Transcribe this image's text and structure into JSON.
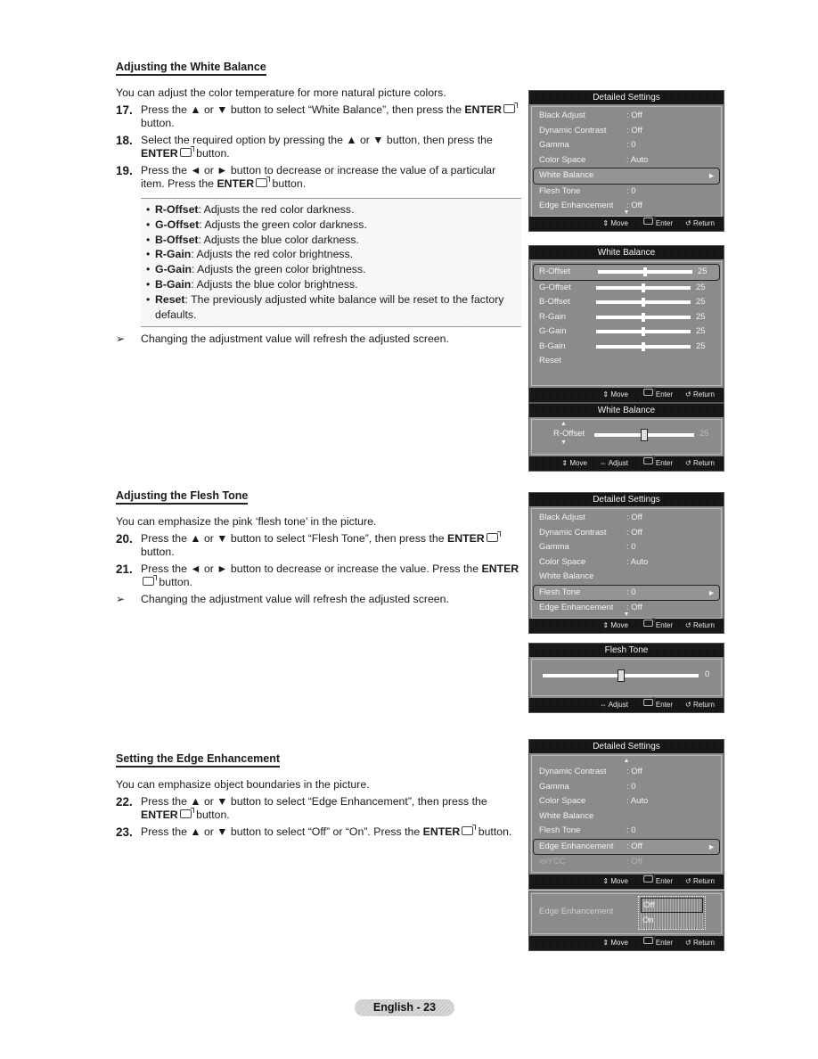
{
  "page": {
    "footer_label": "English - 23"
  },
  "icons": {
    "enter": "enter-icon",
    "up": "▲",
    "down": "▼",
    "left": "◄",
    "right": "►",
    "note": "➢",
    "move": "⇕",
    "adjust": "⇔",
    "return": "↺",
    "go": "►"
  },
  "white_balance": {
    "title": "Adjusting the White Balance",
    "intro": "You can adjust the color temperature for more natural picture colors.",
    "steps": [
      {
        "num": "17.",
        "pre": "Press the ▲ or ▼ button to select “White Balance”, then press the ",
        "bold": "ENTER",
        "post": " button."
      },
      {
        "num": "18.",
        "pre": "Select the required option by pressing the ▲ or ▼ button, then press the ",
        "bold": "ENTER",
        "post": " button."
      },
      {
        "num": "19.",
        "pre": "Press the ◄ or ► button to decrease or increase the value of a particular item. Press the ",
        "bold": "ENTER",
        "post": " button."
      }
    ],
    "bullets": [
      {
        "term": "R-Offset",
        "desc": ": Adjusts the red color darkness."
      },
      {
        "term": "G-Offset",
        "desc": ": Adjusts the green color darkness."
      },
      {
        "term": "B-Offset",
        "desc": ": Adjusts the blue color darkness."
      },
      {
        "term": "R-Gain",
        "desc": ": Adjusts the red color brightness."
      },
      {
        "term": "G-Gain",
        "desc": ": Adjusts the green color brightness."
      },
      {
        "term": "B-Gain",
        "desc": ": Adjusts the blue color brightness."
      },
      {
        "term": "Reset",
        "desc": ": The previously adjusted white balance will be reset to the factory defaults."
      }
    ],
    "note": "Changing the adjustment value will refresh the adjusted screen."
  },
  "flesh_tone": {
    "title": "Adjusting the Flesh Tone",
    "intro": "You can emphasize the pink ‘flesh tone’ in the picture.",
    "steps": [
      {
        "num": "20.",
        "pre": "Press the ▲ or ▼ button to select “Flesh Tone”, then press the ",
        "bold": "ENTER",
        "post": " button."
      },
      {
        "num": "21.",
        "pre": "Press the ◄ or ► button to decrease or increase the value. Press the ",
        "bold": "ENTER",
        "post": " button."
      }
    ],
    "note": "Changing the adjustment value will refresh the adjusted screen."
  },
  "edge": {
    "title": "Setting the Edge Enhancement",
    "intro": "You can emphasize object boundaries in the picture.",
    "steps": [
      {
        "num": "22.",
        "pre": "Press the ▲ or ▼ button to select “Edge Enhancement”, then press the ",
        "bold": "ENTER",
        "post": " button."
      },
      {
        "num": "23.",
        "pre": "Press the ▲ or ▼ button to select “Off” or “On”. Press the ",
        "bold": "ENTER",
        "post": " button."
      }
    ]
  },
  "osd": {
    "footer": {
      "move": "Move",
      "adjust": "Adjust",
      "enter": "Enter",
      "return": "Return"
    },
    "detailed1": {
      "title": "Detailed Settings",
      "rows": [
        {
          "label": "Black Adjust",
          "value": ": Off"
        },
        {
          "label": "Dynamic Contrast",
          "value": ": Off"
        },
        {
          "label": "Gamma",
          "value": ": 0"
        },
        {
          "label": "Color Space",
          "value": ": Auto"
        },
        {
          "label": "White Balance",
          "value": "",
          "selected": true
        },
        {
          "label": "Flesh Tone",
          "value": ": 0"
        },
        {
          "label": "Edge Enhancement",
          "value": ": Off"
        }
      ]
    },
    "wb_menu": {
      "title": "White Balance",
      "range": [
        0,
        50
      ],
      "rows": [
        {
          "label": "R-Offset",
          "value": 25,
          "selected": true
        },
        {
          "label": "G-Offset",
          "value": 25
        },
        {
          "label": "B-Offset",
          "value": 25
        },
        {
          "label": "R-Gain",
          "value": 25
        },
        {
          "label": "G-Gain",
          "value": 25
        },
        {
          "label": "B-Gain",
          "value": 25
        }
      ],
      "reset_label": "Reset"
    },
    "wb_adjust": {
      "title": "White Balance",
      "label": "R-Offset",
      "value": 25,
      "range": [
        0,
        50
      ]
    },
    "detailed2": {
      "title": "Detailed Settings",
      "rows": [
        {
          "label": "Black Adjust",
          "value": ": Off"
        },
        {
          "label": "Dynamic Contrast",
          "value": ": Off"
        },
        {
          "label": "Gamma",
          "value": ": 0"
        },
        {
          "label": "Color Space",
          "value": ": Auto"
        },
        {
          "label": "White Balance",
          "value": ""
        },
        {
          "label": "Flesh Tone",
          "value": ": 0",
          "selected": true
        },
        {
          "label": "Edge Enhancement",
          "value": ": Off"
        }
      ]
    },
    "flesh_adjust": {
      "title": "Flesh Tone",
      "value": 0,
      "range": [
        -15,
        15
      ]
    },
    "detailed3": {
      "title": "Detailed Settings",
      "rows": [
        {
          "label": "Dynamic Contrast",
          "value": ": Off"
        },
        {
          "label": "Gamma",
          "value": ": 0"
        },
        {
          "label": "Color Space",
          "value": ": Auto"
        },
        {
          "label": "White Balance",
          "value": ""
        },
        {
          "label": "Flesh Tone",
          "value": ": 0"
        },
        {
          "label": "Edge Enhancement",
          "value": ": Off",
          "selected": true
        },
        {
          "label": "xvYCC",
          "value": ": Off",
          "disabled": true
        }
      ]
    },
    "edge_select": {
      "label": "Edge Enhancement",
      "options": [
        "Off",
        "On"
      ],
      "selected": "Off"
    }
  }
}
